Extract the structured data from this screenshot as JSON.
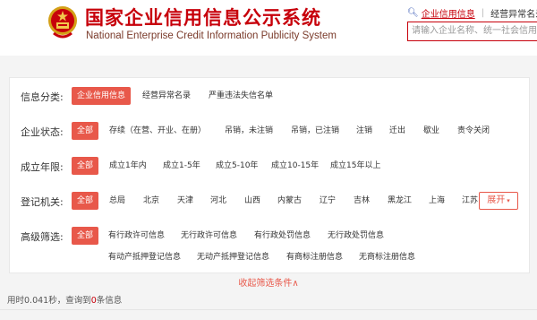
{
  "header": {
    "title": "国家企业信用信息公示系统",
    "subtitle": "National Enterprise Credit Information Publicity System",
    "links": {
      "active": "企业信用信息",
      "other": "经营异常名录"
    },
    "search_placeholder": "请输入企业名称、统一社会信用代码"
  },
  "filters": {
    "category": {
      "label": "信息分类:",
      "options": [
        "企业信用信息",
        "经营异常名录",
        "严重违法失信名单"
      ]
    },
    "status": {
      "label": "企业状态:",
      "options": [
        "全部",
        "存续（在营、开业、在册）",
        "吊销，未注销",
        "吊销，已注销",
        "注销",
        "迁出",
        "歇业",
        "责令关闭"
      ]
    },
    "years": {
      "label": "成立年限:",
      "options": [
        "全部",
        "成立1年内",
        "成立1-5年",
        "成立5-10年",
        "成立10-15年",
        "成立15年以上"
      ]
    },
    "authority": {
      "label": "登记机关:",
      "options": [
        "全部",
        "总局",
        "北京",
        "天津",
        "河北",
        "山西",
        "内蒙古",
        "辽宁",
        "吉林",
        "黑龙江",
        "上海",
        "江苏"
      ],
      "expand": "展开"
    },
    "advanced": {
      "label": "高级筛选:",
      "row1": [
        "全部",
        "有行政许可信息",
        "无行政许可信息",
        "有行政处罚信息",
        "无行政处罚信息"
      ],
      "row2": [
        "有动产抵押登记信息",
        "无动产抵押登记信息",
        "有商标注册信息",
        "无商标注册信息"
      ]
    }
  },
  "collapse_label": "收起筛选条件∧",
  "result": {
    "prefix": "用时0.041秒，查询到",
    "count": "0",
    "suffix": "条信息"
  }
}
